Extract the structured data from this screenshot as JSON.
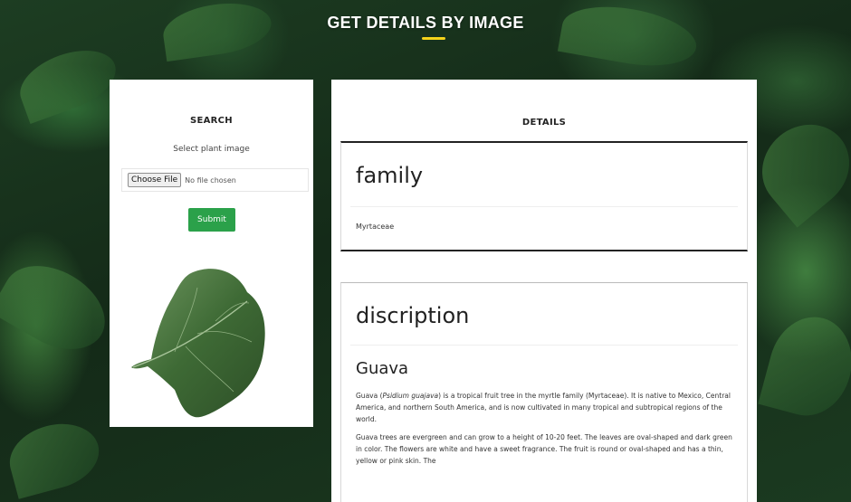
{
  "page": {
    "title": "GET DETAILS BY IMAGE"
  },
  "search": {
    "heading": "SEARCH",
    "select_label": "Select plant image",
    "file_button": "Choose File",
    "file_status": "No file chosen",
    "submit_label": "Submit",
    "submit_color": "#2ba14a"
  },
  "details": {
    "heading": "DETAILS",
    "family": {
      "heading": "family",
      "value": "Myrtaceae"
    },
    "description": {
      "heading": "discription",
      "plant_name": "Guava",
      "para1_pre": "Guava (",
      "para1_italic": "Psidium guajava",
      "para1_post": ") is a tropical fruit tree in the myrtle family (Myrtaceae). It is native to Mexico, Central America, and northern South America, and is now cultivated in many tropical and subtropical regions of the world.",
      "para2": "Guava trees are evergreen and can grow to a height of 10-20 feet. The leaves are oval-shaped and dark green in color. The flowers are white and have a sweet fragrance. The fruit is round or oval-shaped and has a thin, yellow or pink skin. The"
    }
  },
  "colors": {
    "accent_bar": "#f5d31b",
    "background": "#16301c"
  }
}
